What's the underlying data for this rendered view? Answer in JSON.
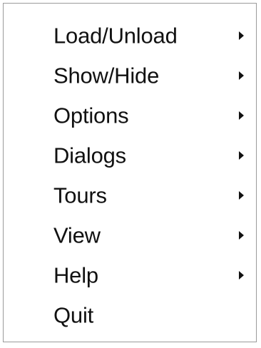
{
  "menu": {
    "items": [
      {
        "label": "Load/Unload",
        "has_submenu": true,
        "icon": "chevron-right-icon"
      },
      {
        "label": "Show/Hide",
        "has_submenu": true,
        "icon": "chevron-right-icon"
      },
      {
        "label": "Options",
        "has_submenu": true,
        "icon": "chevron-right-icon"
      },
      {
        "label": "Dialogs",
        "has_submenu": true,
        "icon": "chevron-right-icon"
      },
      {
        "label": "Tours",
        "has_submenu": true,
        "icon": "chevron-right-icon"
      },
      {
        "label": "View",
        "has_submenu": true,
        "icon": "chevron-right-icon"
      },
      {
        "label": "Help",
        "has_submenu": true,
        "icon": "chevron-right-icon"
      },
      {
        "label": "Quit",
        "has_submenu": false
      }
    ],
    "colors": {
      "text": "#111111",
      "border": "#9a9a9a",
      "background": "#ffffff"
    }
  }
}
